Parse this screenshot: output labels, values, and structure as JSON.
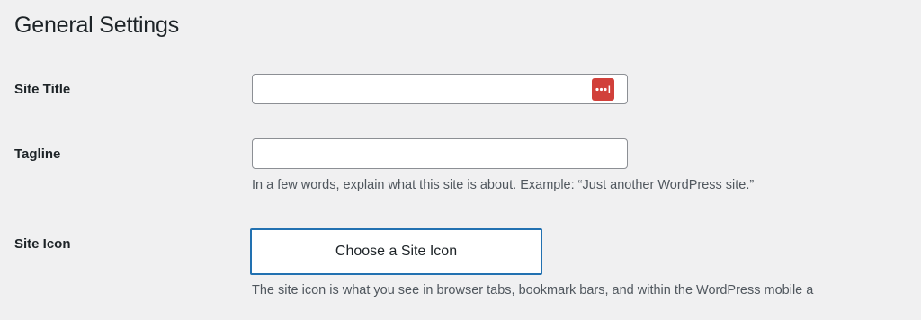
{
  "page": {
    "title": "General Settings"
  },
  "fields": {
    "site_title": {
      "label": "Site Title",
      "value": "",
      "password_manager_icon": "lastpass-icon"
    },
    "tagline": {
      "label": "Tagline",
      "value": "",
      "description": "In a few words, explain what this site is about. Example: “Just another WordPress site.”"
    },
    "site_icon": {
      "label": "Site Icon",
      "button_label": "Choose a Site Icon",
      "description": "The site icon is what you see in browser tabs, bookmark bars, and within the WordPress mobile a"
    }
  },
  "colors": {
    "background": "#f0f0f1",
    "accent": "#2271b1",
    "lastpass_red": "#d1403a"
  }
}
